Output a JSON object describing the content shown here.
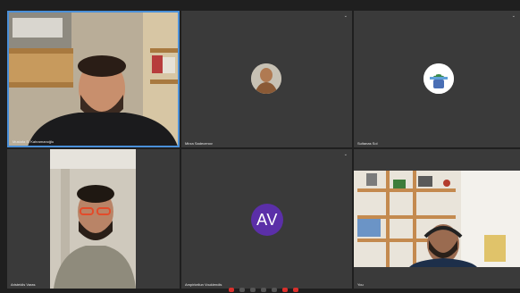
{
  "participants": [
    {
      "name": "Mustafa S. Kahramanoğlu",
      "kind": "video",
      "active": true
    },
    {
      "name": "Mirza Sadecenov",
      "kind": "photo-avatar",
      "icon": "muted-mic-icon"
    },
    {
      "name": "Sultanas Sol",
      "kind": "android-avatar",
      "icon": "muted-mic-icon"
    },
    {
      "name": "Aristeidis Varas",
      "kind": "video"
    },
    {
      "name": "Ampirkeliun Vouklendis",
      "kind": "initials",
      "initials": "AV",
      "color": "#5b2fa8",
      "icon": "muted-mic-icon"
    },
    {
      "name": "You",
      "kind": "video"
    }
  ]
}
